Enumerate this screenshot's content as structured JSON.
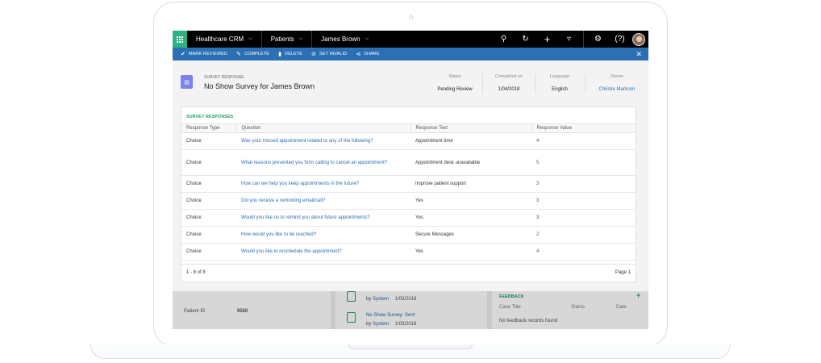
{
  "nav": {
    "app_name": "Healthcare CRM",
    "area": "Patients",
    "record": "James Brown"
  },
  "commands": {
    "mark_reviewed": "MARK REVIEWED",
    "complete": "COMPLETE",
    "delete": "DELETE",
    "set_invalid": "SET INVALID",
    "share": "SHARE"
  },
  "header": {
    "entity_type": "SURVEY RESPONSE",
    "title": "No Show Survey for James Brown",
    "fields": [
      {
        "label": "Status",
        "value": "Pending Review"
      },
      {
        "label": "Completed on",
        "value": "1/04/2018"
      },
      {
        "label": "Language",
        "value": "English"
      },
      {
        "label": "Owner",
        "value": "Christie Markson"
      }
    ]
  },
  "survey": {
    "section_title": "SURVEY RESPONSES",
    "columns": [
      "Response Type",
      "Question",
      "Response Text",
      "Response Value"
    ],
    "rows": [
      {
        "type": "Choice",
        "question": "Was your missed appointment related to any of the following?",
        "text": "Appointment time",
        "value": "4"
      },
      {
        "type": "Choice",
        "question": "What reasons prevented you form calling to cancel an appointment?",
        "text": "Appointment desk unavailable",
        "value": "5"
      },
      {
        "type": "Choice",
        "question": "How can we help you keep appointments in the future?",
        "text": "Improve patient support",
        "value": "3"
      },
      {
        "type": "Choice",
        "question": "Did you receive a reminding email/call?",
        "text": "Yes",
        "value": "3"
      },
      {
        "type": "Choice",
        "question": "Would you like us to remind you about future appointments?",
        "text": "Yes",
        "value": "3"
      },
      {
        "type": "Choice",
        "question": "How would you like to be reached?",
        "text": "Secure Messages",
        "value": "2"
      },
      {
        "type": "Choice",
        "question": "Would you like to reschedule the appointment?",
        "text": "Yes",
        "value": "4"
      }
    ],
    "count_text": "1 - 8 of 8",
    "page_text": "Page 1"
  },
  "background": {
    "patient_id_label": "Patient ID",
    "patient_id_value": "9550",
    "timeline": [
      {
        "by_label": "by",
        "by_user": "System",
        "date": "1/03/2018"
      },
      {
        "title": "No Show Survey: Sent",
        "by_label": "by",
        "by_user": "System",
        "date": "1/03/2018"
      }
    ],
    "feedback": {
      "title": "FEEDBACK",
      "columns": [
        "Case Title",
        "Status",
        "Date"
      ],
      "empty": "No feedback records found"
    }
  }
}
